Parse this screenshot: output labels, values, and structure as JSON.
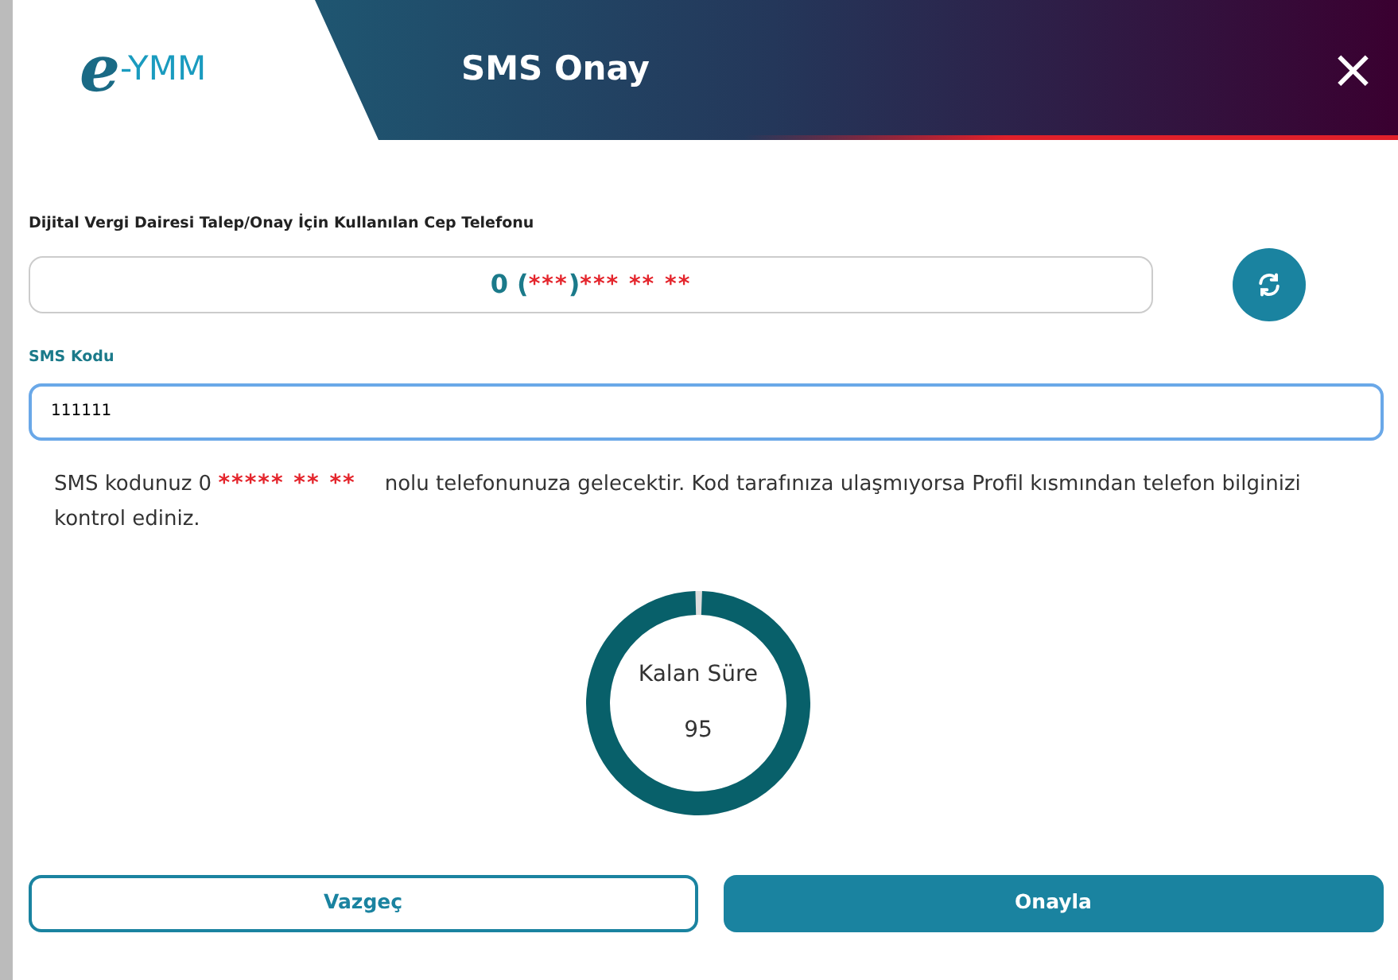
{
  "header": {
    "logo_e": "e",
    "logo_text": "-YMM",
    "title": "SMS Onay",
    "close": "×"
  },
  "phone": {
    "label": "Dijital Vergi Dairesi Talep/Onay İçin Kullanılan Cep Telefonu",
    "parts": [
      {
        "kind": "plain",
        "text": "0 ("
      },
      {
        "kind": "masked",
        "text": "***"
      },
      {
        "kind": "plain",
        "text": ")"
      },
      {
        "kind": "masked",
        "text": "*** ** **"
      }
    ]
  },
  "sms": {
    "label": "SMS Kodu",
    "value": "111111"
  },
  "message": {
    "parts": [
      {
        "kind": "plain",
        "text": "SMS kodunuz 0 "
      },
      {
        "kind": "masked",
        "text": "***** ** **"
      },
      {
        "kind": "plain",
        "text": "nolu telefonunuza gelecektir. Kod tarafınıza ulaşmıyorsa Profil kısmından telefon bilginizi kontrol ediniz."
      }
    ]
  },
  "timer": {
    "label": "Kalan Süre",
    "value": "95",
    "level": 0.99
  },
  "buttons": [
    {
      "kind": "outline",
      "label": "Vazgeç"
    },
    {
      "kind": "primary",
      "label": "Onayla"
    }
  ]
}
